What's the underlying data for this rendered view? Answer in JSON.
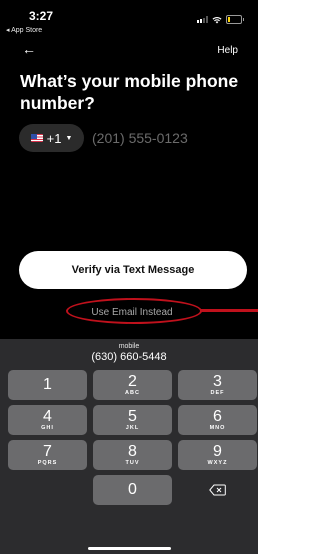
{
  "status_bar": {
    "time": "3:27",
    "back_app": "◂ App Store"
  },
  "nav": {
    "back_icon": "←",
    "help_label": "Help"
  },
  "title": "What’s your mobile phone number?",
  "phone": {
    "country_code": "+1",
    "placeholder": "(201) 555-0123",
    "value": ""
  },
  "actions": {
    "verify_label": "Verify via Text Message",
    "email_label": "Use Email Instead"
  },
  "keyboard": {
    "suggestion_label": "mobile",
    "suggestion_number": "(630) 660-5448",
    "keys": [
      {
        "digit": "1",
        "letters": ""
      },
      {
        "digit": "2",
        "letters": "ABC"
      },
      {
        "digit": "3",
        "letters": "DEF"
      },
      {
        "digit": "4",
        "letters": "GHI"
      },
      {
        "digit": "5",
        "letters": "JKL"
      },
      {
        "digit": "6",
        "letters": "MNO"
      },
      {
        "digit": "7",
        "letters": "PQRS"
      },
      {
        "digit": "8",
        "letters": "TUV"
      },
      {
        "digit": "9",
        "letters": "WXYZ"
      },
      {
        "digit": "0",
        "letters": ""
      }
    ]
  },
  "colors": {
    "background": "#000000",
    "keyboard": "#2c2c2e",
    "key": "#6b6b6d",
    "annotation": "#c0111c"
  }
}
